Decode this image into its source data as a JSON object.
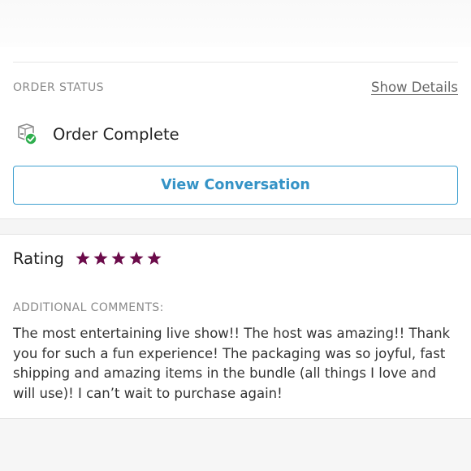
{
  "order": {
    "section_label": "ORDER STATUS",
    "show_details_label": "Show Details",
    "status_icon": "package-check-icon",
    "status_text": "Order Complete",
    "view_conversation_label": "View Conversation"
  },
  "review": {
    "rating_label": "Rating",
    "rating_value": 5,
    "rating_max": 5,
    "star_icon": "star-icon",
    "star_color": "#6b0b4a",
    "comments_label": "ADDITIONAL COMMENTS:",
    "comments_text": "The most entertaining live show!! The host was amazing!! Thank you for such a fun experience! The packaging was so joyful, fast shipping and amazing items in the bundle (all things I love and will use)! I can’t wait to purchase again!"
  },
  "colors": {
    "accent": "#3593c6",
    "success": "#2fae4e",
    "label_gray": "#8a8a8a"
  }
}
